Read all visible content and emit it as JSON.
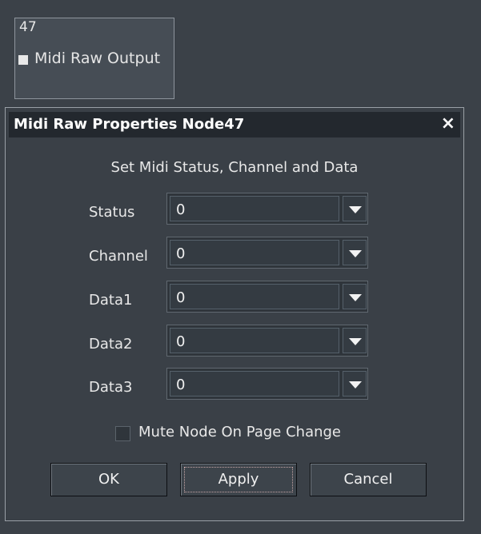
{
  "node": {
    "id": "47",
    "label": "Midi Raw Output"
  },
  "dialog": {
    "title": "Midi Raw Properties Node47",
    "close_glyph": "×",
    "subtitle": "Set Midi Status, Channel and Data",
    "rows": [
      {
        "label": "Status",
        "value": "0"
      },
      {
        "label": "Channel",
        "value": "0"
      },
      {
        "label": "Data1",
        "value": "0"
      },
      {
        "label": "Data2",
        "value": "0"
      },
      {
        "label": "Data3",
        "value": "0"
      }
    ],
    "mute_checkbox": {
      "label": "Mute Node On Page Change",
      "checked": false
    },
    "buttons": {
      "ok": "OK",
      "apply": "Apply",
      "cancel": "Cancel"
    }
  }
}
